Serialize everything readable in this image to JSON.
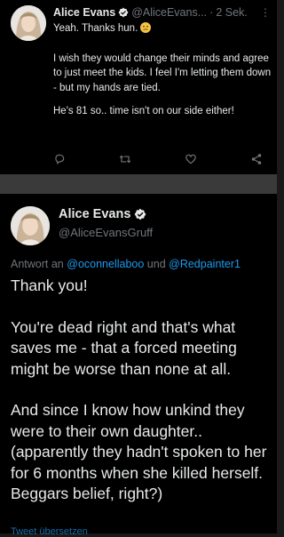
{
  "tweet1": {
    "name": "Alice Evans",
    "handle": "@AliceEvans...",
    "separator": "·",
    "time": "2 Sek.",
    "more": "⋮",
    "text_first": "Yeah. Thanks hun.",
    "emoji": "confused-face",
    "text_second": "I wish they would change their minds and agree to just meet the kids. I feel I'm letting them down - but my hands are tied.",
    "text_third": "He's 81 so..  time isn't on our side either!",
    "actions": [
      "reply-icon",
      "retweet-icon",
      "like-icon",
      "share-icon"
    ]
  },
  "tweet2": {
    "name": "Alice Evans",
    "handle": "@AliceEvansGruff",
    "reply_prefix": "Antwort an",
    "reply_to_1": "@oconnellaboo",
    "reply_and": "und",
    "reply_to_2": "@Redpainter1",
    "paragraph1": "Thank you!",
    "paragraph2": "You're dead right and that's what saves me - that a forced meeting might be worse than none at all.",
    "paragraph3": "And since I know how unkind they were to their own daughter.. (apparently they hadn't spoken to her for 6 months when she killed herself. Beggars belief, right?)",
    "translate": "Tweet übersetzen"
  },
  "colors": {
    "background": "#000000",
    "text": "#e7e9ea",
    "muted": "#71767b",
    "link": "#1d9bf0",
    "verified": "#1d9bf0"
  }
}
